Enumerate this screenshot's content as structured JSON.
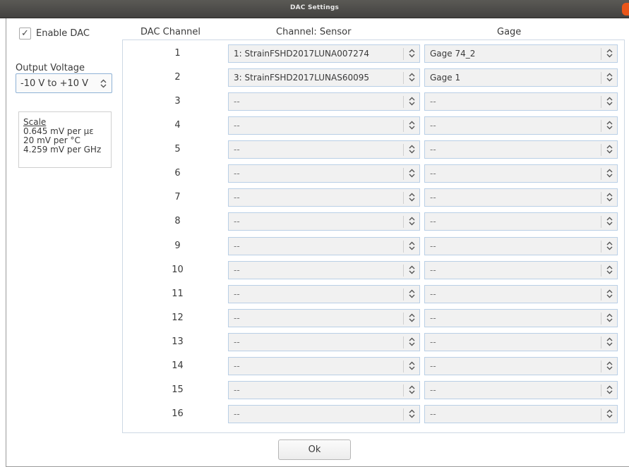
{
  "window": {
    "title": "DAC Settings"
  },
  "enable_dac": {
    "label": "Enable DAC",
    "checked": true,
    "check_glyph": "✓"
  },
  "output_voltage": {
    "label": "Output Voltage",
    "value": "-10 V to +10 V"
  },
  "scale": {
    "title": "Scale",
    "lines": [
      "0.645 mV per µε",
      "20 mV per °C",
      "4.259 mV per GHz"
    ]
  },
  "table": {
    "headers": {
      "channel": "DAC Channel",
      "sensor": "Channel: Sensor",
      "gage": "Gage"
    },
    "rows": [
      {
        "channel": "1",
        "sensor": "1: StrainFSHD2017LUNA007274",
        "gage": "Gage 74_2"
      },
      {
        "channel": "2",
        "sensor": "3: StrainFSHD2017LUNAS60095",
        "gage": "Gage 1"
      },
      {
        "channel": "3",
        "sensor": "--",
        "gage": "--"
      },
      {
        "channel": "4",
        "sensor": "--",
        "gage": "--"
      },
      {
        "channel": "5",
        "sensor": "--",
        "gage": "--"
      },
      {
        "channel": "6",
        "sensor": "--",
        "gage": "--"
      },
      {
        "channel": "7",
        "sensor": "--",
        "gage": "--"
      },
      {
        "channel": "8",
        "sensor": "--",
        "gage": "--"
      },
      {
        "channel": "9",
        "sensor": "--",
        "gage": "--"
      },
      {
        "channel": "10",
        "sensor": "--",
        "gage": "--"
      },
      {
        "channel": "11",
        "sensor": "--",
        "gage": "--"
      },
      {
        "channel": "12",
        "sensor": "--",
        "gage": "--"
      },
      {
        "channel": "13",
        "sensor": "--",
        "gage": "--"
      },
      {
        "channel": "14",
        "sensor": "--",
        "gage": "--"
      },
      {
        "channel": "15",
        "sensor": "--",
        "gage": "--"
      },
      {
        "channel": "16",
        "sensor": "--",
        "gage": "--"
      }
    ]
  },
  "ok_button": {
    "label": "Ok"
  },
  "colors": {
    "titlebar": "#4e4d4a",
    "close": "#e9561a",
    "select_border": "#b9cfe6"
  },
  "icons": {
    "dropdown": "up-down-chevron-icon",
    "check": "checkmark-icon"
  }
}
